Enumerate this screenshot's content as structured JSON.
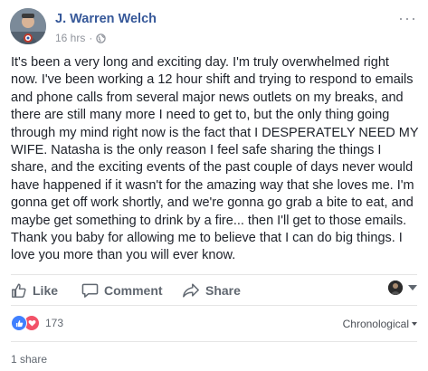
{
  "post": {
    "author": "J. Warren Welch",
    "time": "16 hrs",
    "separator": "·",
    "privacy_icon": "globe-icon",
    "more_icon": "ellipsis-icon",
    "text": "It's been a very long and exciting day. I'm truly overwhelmed right now. I've been working a 12 hour shift and trying to respond to emails and phone calls from several major news outlets on my breaks, and there are still many more I need to get to, but the only thing going through my mind right now is the fact that I DESPERATELY NEED MY WIFE. Natasha is the only reason I feel safe sharing the things I share, and the exciting events of the past couple of days never would have happened if it wasn't for the amazing way that she loves me. I'm gonna get off work shortly, and we're gonna go grab a bite to eat, and maybe get something to drink by a fire... then I'll get to those emails. Thank you baby for allowing me to believe that I can do big things. I love you more than you will ever know."
  },
  "actions": {
    "like_label": "Like",
    "comment_label": "Comment",
    "share_label": "Share"
  },
  "reactions": {
    "types": [
      "like",
      "love"
    ],
    "count": "173",
    "sort_label": "Chronological"
  },
  "shares": {
    "label": "1 share"
  },
  "colors": {
    "author_link": "#365899",
    "like_blue": "#4080ff",
    "love_red": "#f25268",
    "meta_gray": "#90949c"
  }
}
